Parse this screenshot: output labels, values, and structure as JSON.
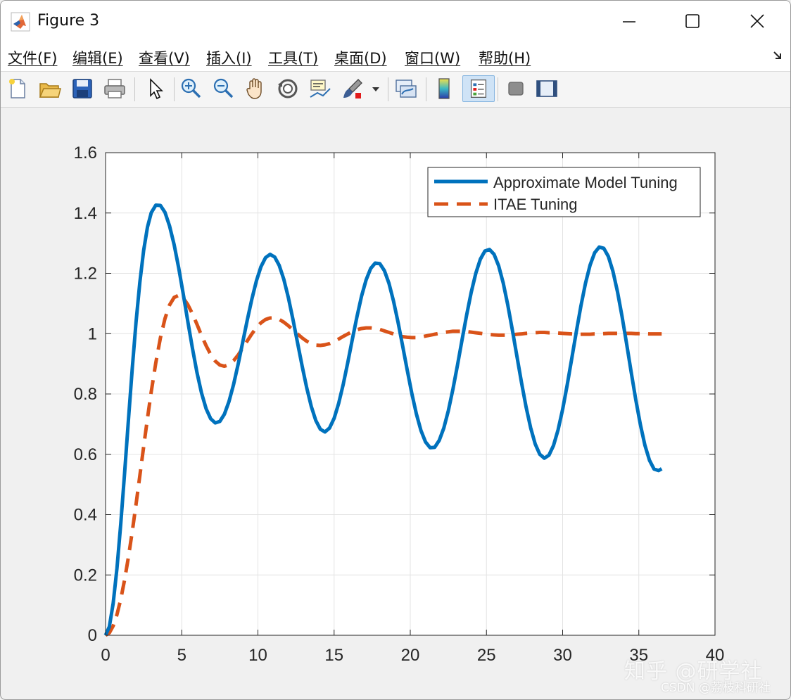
{
  "window": {
    "title": "Figure 3",
    "menu": [
      "文件(F)",
      "编辑(E)",
      "查看(V)",
      "插入(I)",
      "工具(T)",
      "桌面(D)",
      "窗口(W)",
      "帮助(H)"
    ]
  },
  "toolbar": {
    "icons": [
      "new-figure-icon",
      "open-file-icon",
      "save-icon",
      "print-icon",
      "select-arrow-icon",
      "zoom-in-icon",
      "zoom-out-icon",
      "pan-hand-icon",
      "rotate-3d-icon",
      "data-cursor-icon",
      "brush-icon",
      "link-plot-icon",
      "colorbar-icon",
      "legend-icon",
      "hide-plot-tools-icon",
      "show-plot-tools-icon"
    ],
    "active": "legend-icon"
  },
  "colors": {
    "series1": "#0072BD",
    "series2": "#D95319",
    "grid": "#e3e3e3"
  },
  "chart_data": {
    "type": "line",
    "title": "",
    "xlabel": "",
    "ylabel": "",
    "xlim": [
      0,
      40
    ],
    "ylim": [
      0,
      1.6
    ],
    "xticks": [
      0,
      5,
      10,
      15,
      20,
      25,
      30,
      35,
      40
    ],
    "yticks": [
      0,
      0.2,
      0.4,
      0.6,
      0.8,
      1,
      1.2,
      1.4,
      1.6
    ],
    "ytick_labels": [
      "0",
      "0.2",
      "0.4",
      "0.6",
      "0.8",
      "1",
      "1.2",
      "1.4",
      "1.6"
    ],
    "grid": true,
    "legend_position": "top-right",
    "series": [
      {
        "name": "Approximate Model Tuning",
        "style": "solid",
        "x": [
          0,
          0.25,
          0.5,
          0.75,
          1,
          1.25,
          1.5,
          1.75,
          2,
          2.25,
          2.5,
          2.75,
          3,
          3.3,
          3.6,
          3.9,
          4.2,
          4.5,
          4.8,
          5.1,
          5.4,
          5.7,
          6,
          6.3,
          6.6,
          6.9,
          7.2,
          7.5,
          7.8,
          8.1,
          8.4,
          8.7,
          9,
          9.3,
          9.6,
          9.9,
          10.2,
          10.5,
          10.8,
          11.1,
          11.4,
          11.7,
          12,
          12.3,
          12.6,
          12.9,
          13.2,
          13.5,
          13.8,
          14.1,
          14.4,
          14.7,
          15,
          15.3,
          15.6,
          15.9,
          16.2,
          16.5,
          16.8,
          17.1,
          17.4,
          17.7,
          18,
          18.3,
          18.6,
          18.9,
          19.2,
          19.5,
          19.8,
          20.1,
          20.4,
          20.7,
          21,
          21.3,
          21.6,
          21.9,
          22.2,
          22.5,
          22.8,
          23.1,
          23.4,
          23.7,
          24,
          24.3,
          24.6,
          24.9,
          25.2,
          25.5,
          25.8,
          26.1,
          26.4,
          26.7,
          27,
          27.3,
          27.6,
          27.9,
          28.2,
          28.5,
          28.8,
          29.1,
          29.4,
          29.7,
          30,
          30.3,
          30.6,
          30.9,
          31.2,
          31.5,
          31.8,
          32.1,
          32.4,
          32.7,
          33,
          33.3,
          33.6,
          33.9,
          34.2,
          34.5,
          34.8,
          35.1,
          35.4,
          35.7,
          36,
          36.3,
          36.5
        ],
        "y": [
          0,
          0.029,
          0.106,
          0.223,
          0.371,
          0.538,
          0.713,
          0.883,
          1.038,
          1.17,
          1.276,
          1.353,
          1.401,
          1.426,
          1.425,
          1.402,
          1.357,
          1.295,
          1.218,
          1.131,
          1.04,
          0.952,
          0.871,
          0.803,
          0.751,
          0.718,
          0.704,
          0.709,
          0.733,
          0.775,
          0.831,
          0.898,
          0.971,
          1.045,
          1.114,
          1.175,
          1.222,
          1.252,
          1.263,
          1.254,
          1.226,
          1.18,
          1.119,
          1.047,
          0.97,
          0.893,
          0.821,
          0.759,
          0.712,
          0.683,
          0.674,
          0.687,
          0.719,
          0.769,
          0.832,
          0.905,
          0.982,
          1.056,
          1.124,
          1.178,
          1.216,
          1.234,
          1.232,
          1.209,
          1.167,
          1.108,
          1.037,
          0.959,
          0.879,
          0.802,
          0.734,
          0.679,
          0.641,
          0.622,
          0.623,
          0.646,
          0.687,
          0.745,
          0.816,
          0.896,
          0.98,
          1.062,
          1.137,
          1.2,
          1.247,
          1.274,
          1.279,
          1.263,
          1.225,
          1.168,
          1.095,
          1.012,
          0.925,
          0.838,
          0.757,
          0.688,
          0.634,
          0.6,
          0.587,
          0.597,
          0.629,
          0.681,
          0.749,
          0.83,
          0.918,
          1.007,
          1.092,
          1.167,
          1.227,
          1.268,
          1.287,
          1.283,
          1.256,
          1.207,
          1.139,
          1.057,
          0.966,
          0.872,
          0.781,
          0.699,
          0.63,
          0.58,
          0.551,
          0.546,
          0.552
        ]
      },
      {
        "name": "ITAE Tuning",
        "style": "dashed",
        "x": [
          0,
          0.25,
          0.5,
          0.75,
          1,
          1.25,
          1.5,
          1.75,
          2,
          2.25,
          2.5,
          2.75,
          3,
          3.3,
          3.6,
          3.9,
          4.2,
          4.5,
          4.8,
          5.1,
          5.4,
          5.7,
          6,
          6.3,
          6.6,
          6.9,
          7.2,
          7.5,
          7.8,
          8.1,
          8.4,
          8.7,
          9,
          9.3,
          9.6,
          9.9,
          10.2,
          10.5,
          10.8,
          11.1,
          11.4,
          11.7,
          12,
          12.3,
          12.6,
          12.9,
          13.2,
          13.5,
          13.8,
          14.1,
          14.4,
          14.7,
          15,
          15.3,
          15.6,
          15.9,
          16.2,
          16.5,
          16.8,
          17.1,
          17.4,
          17.7,
          18,
          18.3,
          18.6,
          18.9,
          19.2,
          19.5,
          19.8,
          20.1,
          20.4,
          20.7,
          21,
          21.3,
          21.6,
          21.9,
          22.2,
          22.5,
          22.8,
          23.1,
          23.4,
          23.7,
          24,
          24.3,
          24.6,
          24.9,
          25.2,
          25.5,
          25.8,
          26.1,
          26.4,
          26.7,
          27,
          27.3,
          27.6,
          27.9,
          28.2,
          28.5,
          28.8,
          29.1,
          29.4,
          29.7,
          30,
          30.3,
          30.6,
          30.9,
          31.2,
          31.5,
          31.8,
          32.1,
          32.4,
          32.7,
          33,
          33.3,
          33.6,
          33.9,
          34.2,
          34.5,
          34.8,
          35.1,
          35.4,
          35.7,
          36,
          36.3,
          36.5
        ],
        "y": [
          0,
          0.008,
          0.031,
          0.069,
          0.12,
          0.184,
          0.259,
          0.343,
          0.434,
          0.529,
          0.625,
          0.719,
          0.808,
          0.904,
          0.986,
          1.05,
          1.095,
          1.12,
          1.127,
          1.118,
          1.096,
          1.066,
          1.031,
          0.994,
          0.96,
          0.931,
          0.909,
          0.896,
          0.892,
          0.897,
          0.91,
          0.929,
          0.952,
          0.976,
          0.999,
          1.02,
          1.036,
          1.047,
          1.052,
          1.052,
          1.047,
          1.038,
          1.026,
          1.013,
          0.999,
          0.986,
          0.975,
          0.967,
          0.962,
          0.961,
          0.963,
          0.967,
          0.974,
          0.982,
          0.991,
          0.999,
          1.007,
          1.013,
          1.017,
          1.019,
          1.019,
          1.017,
          1.014,
          1.009,
          1.004,
          0.999,
          0.994,
          0.99,
          0.988,
          0.987,
          0.987,
          0.989,
          0.992,
          0.995,
          0.998,
          1.001,
          1.004,
          1.006,
          1.008,
          1.008,
          1.008,
          1.007,
          1.005,
          1.003,
          1.001,
          0.999,
          0.997,
          0.996,
          0.995,
          0.995,
          0.995,
          0.996,
          0.998,
          0.999,
          1.001,
          1.002,
          1.003,
          1.004,
          1.004,
          1.003,
          1.003,
          1.002,
          1.001,
          1,
          0.999,
          0.998,
          0.998,
          0.998,
          0.998,
          0.999,
          0.999,
          1,
          1.001,
          1.001,
          1.001,
          1.001,
          1.001,
          1.001,
          1,
          1,
          1,
          0.999,
          0.999,
          0.999,
          0.999
        ]
      }
    ]
  },
  "watermark": {
    "line1": "知乎 @研学社",
    "line2": "CSDN @荔枝科研社"
  }
}
